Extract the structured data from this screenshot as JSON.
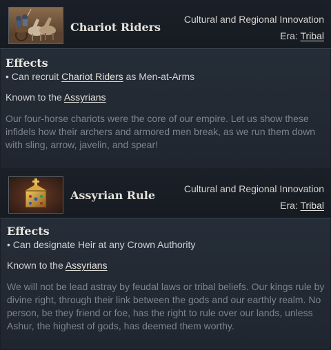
{
  "innovations": [
    {
      "title": "Chariot Riders",
      "category": "Cultural and Regional Innovation",
      "era_label": "Era:",
      "era_value": "Tribal",
      "effects_heading": "Effects",
      "effect_prefix": "• Can recruit ",
      "effect_link": "Chariot Riders",
      "effect_suffix": " as Men-at-Arms",
      "known_prefix": "Known to the ",
      "known_link": "Assyrians",
      "flavor": "Our four-horse chariots were the core of our empire. Let us show these infidels how their archers and armored men break, as we run them down with sling, arrow, javelin, and spear!",
      "icon": "chariot-riders-image"
    },
    {
      "title": "Assyrian Rule",
      "category": "Cultural and Regional Innovation",
      "era_label": "Era:",
      "era_value": "Tribal",
      "effects_heading": "Effects",
      "effect_text": "• Can designate Heir at any Crown Authority",
      "known_prefix": "Known to the ",
      "known_link": "Assyrians",
      "flavor": "We will not be lead astray by feudal laws or tribal beliefs. Our kings rule by divine right, through their link between the gods and our earthly realm. No person, be they friend or foe, has the right to rule over our lands, unless Ashur, the highest of gods, has deemed them worthy.",
      "icon": "crown-reliquary-image"
    }
  ]
}
